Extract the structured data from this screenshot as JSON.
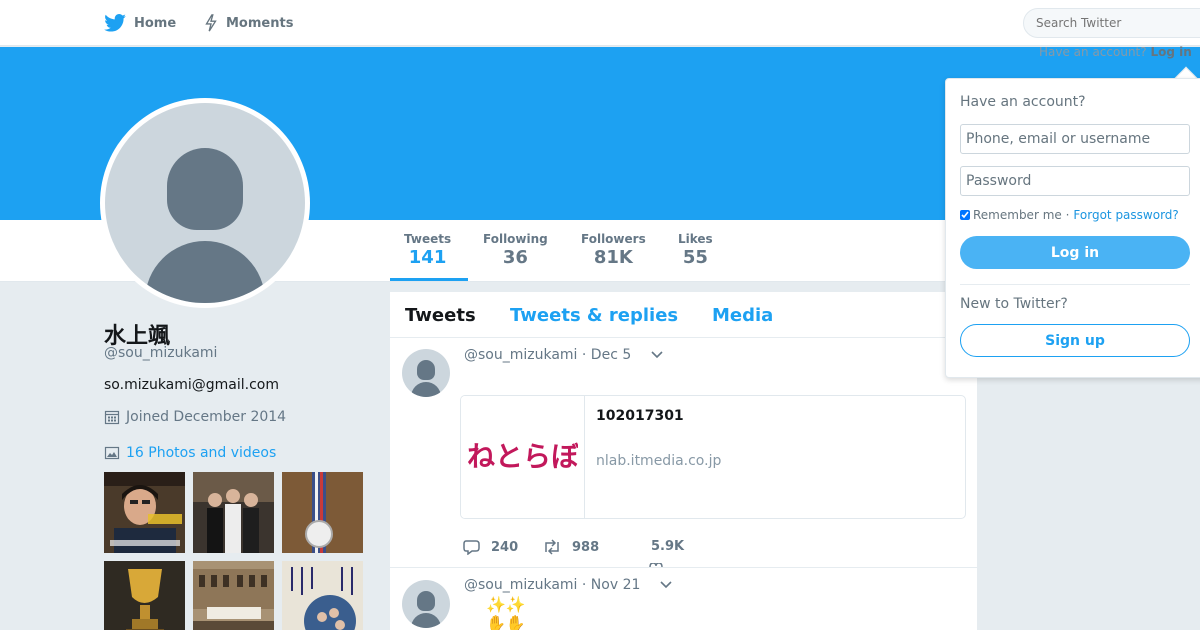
{
  "nav": {
    "home_label": "Home",
    "moments_label": "Moments",
    "search_placeholder": "Search Twitter"
  },
  "banner": {
    "have_account_text": "Have an account?",
    "login_link": "Log in"
  },
  "stats": [
    {
      "label": "Tweets",
      "value": "141"
    },
    {
      "label": "Following",
      "value": "36"
    },
    {
      "label": "Followers",
      "value": "81K"
    },
    {
      "label": "Likes",
      "value": "55"
    }
  ],
  "profile": {
    "name": "水上颯",
    "handle": "@sou_mizukami",
    "bio": "so.mizukami@gmail.com",
    "joined": "Joined December 2014",
    "photos_link": "16 Photos and videos"
  },
  "tabs": {
    "tweets": "Tweets",
    "tweets_replies": "Tweets & replies",
    "media": "Media"
  },
  "tweets": [
    {
      "handle": "@sou_mizukami",
      "date": "· Dec 5",
      "card_title": "102017301",
      "card_domain": "nlab.itmedia.co.jp",
      "card_logo_text": "ねとらぼ",
      "replies": "240",
      "retweets": "988",
      "likes": "5.9K"
    },
    {
      "handle": "@sou_mizukami",
      "date": "· Nov 21",
      "emoji_line1": "✨✨",
      "emoji_line2": "✋✋"
    }
  ],
  "login": {
    "title": "Have an account?",
    "username_placeholder": "Phone, email or username",
    "password_placeholder": "Password",
    "remember_label": "Remember me",
    "separator": "·",
    "forgot_label": "Forgot password?",
    "login_button": "Log in",
    "new_to_twitter": "New to Twitter?",
    "signup_button": "Sign up"
  },
  "colors": {
    "brand": "#1da1f2",
    "background": "#e6ecf0",
    "login_button": "#4ab3f4"
  }
}
